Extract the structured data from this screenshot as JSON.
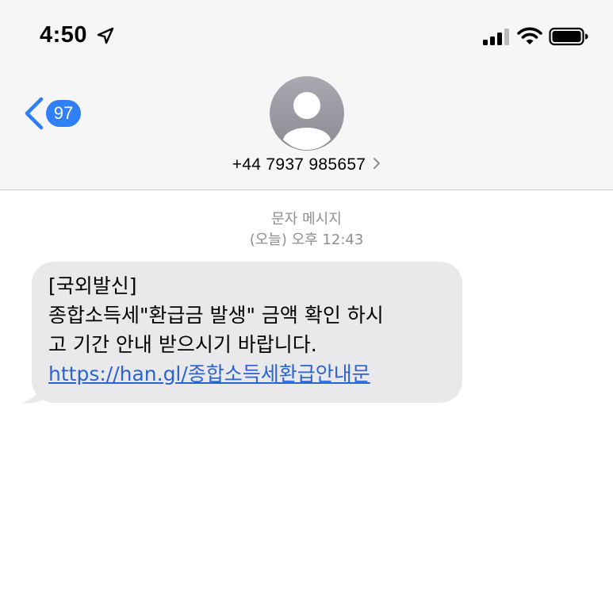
{
  "status_bar": {
    "time": "4:50"
  },
  "nav": {
    "back_count": "97"
  },
  "contact": {
    "number": "+44 7937 985657"
  },
  "thread": {
    "message_kind": "문자 메시지",
    "timestamp": "(오늘) 오후 12:43"
  },
  "message": {
    "line1": "[국외발신]",
    "line2": "종합소득세\"환급금 발생\" 금액 확인 하시",
    "line3": "고 기간 안내 받으시기 바랍니다.",
    "link": "https://han.gl/종합소득세환급안내문"
  },
  "colors": {
    "header_bg": "#f6f6f6",
    "badge": "#2f7ff5",
    "bubble": "#e9e9eb",
    "link": "#2a63d4",
    "avatar": "#9a9ba3"
  }
}
